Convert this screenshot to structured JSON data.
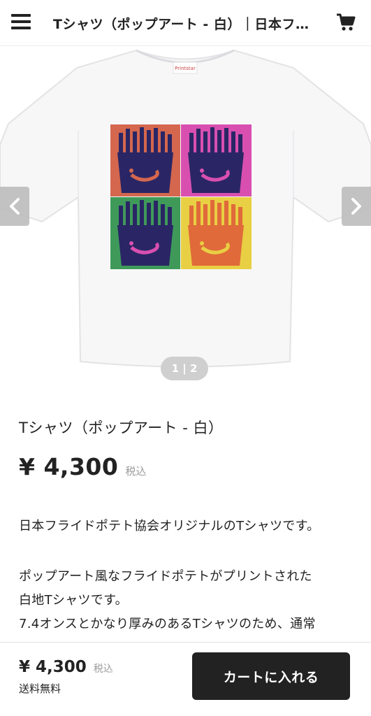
{
  "header": {
    "title": "Tシャツ（ポップアート - 白）｜日本フライドポテト協会",
    "menu_icon": "hamburger-menu-icon",
    "cart_icon": "shopping-cart-icon"
  },
  "gallery": {
    "pager": "1 | 2",
    "prev_icon": "chevron-left-icon",
    "next_icon": "chevron-right-icon",
    "panel_colors": [
      "#d4674e",
      "#d94fb0",
      "#3f9a5a",
      "#e9cf43"
    ]
  },
  "product": {
    "name": "Tシャツ（ポップアート - 白）",
    "price": "¥ 4,300",
    "tax_label": "税込"
  },
  "description": {
    "line1": "日本フライドポテト協会オリジナルのTシャツです。",
    "line2": "ポップアート風なフライドポテトがプリントされた",
    "line3": "白地Tシャツです。",
    "line4": "7.4オンスとかなり厚みのあるTシャツのため、通常"
  },
  "bottom_bar": {
    "price": "¥ 4,300",
    "tax_label": "税込",
    "shipping": "送料無料",
    "add_to_cart": "カートに入れる"
  }
}
